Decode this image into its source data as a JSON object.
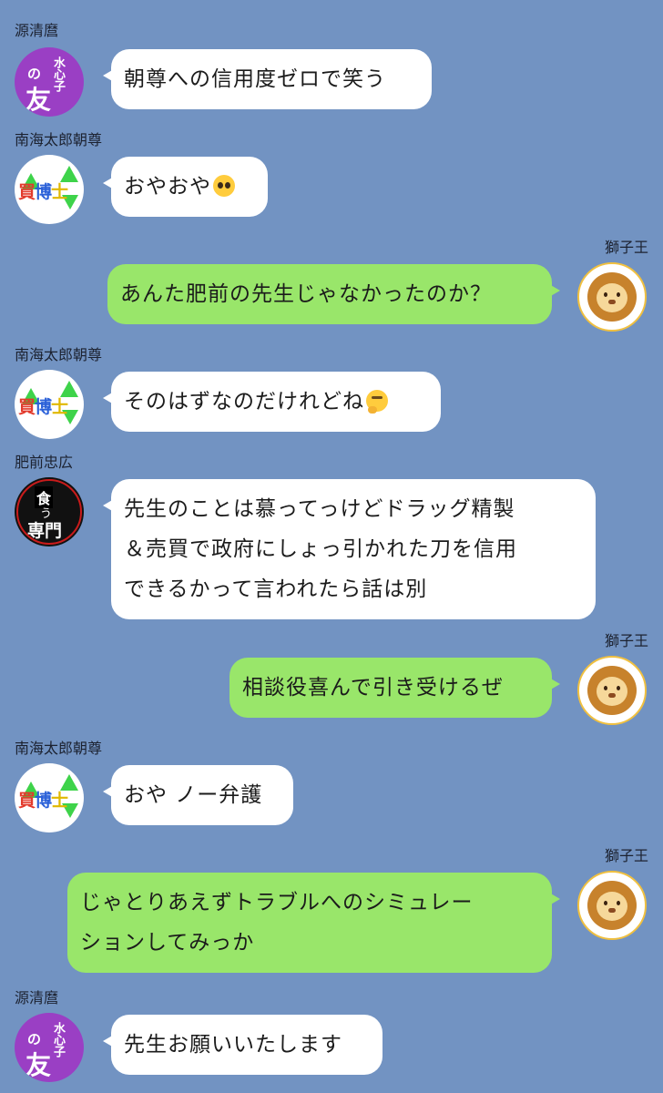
{
  "names": {
    "minamoto": "源清麿",
    "nankai": "南海太郎朝尊",
    "shishio": "獅子王",
    "hizen": "肥前忠広"
  },
  "avatars": {
    "tomo": {
      "line1": "水心子",
      "line2": "の",
      "line3": "友"
    },
    "kai": {
      "c1": "買",
      "c2": "博",
      "c3": "士"
    },
    "kuu": {
      "line1": "食",
      "line2": "う",
      "line3": "専門"
    }
  },
  "messages": [
    {
      "sender": "源清麿",
      "text": "朝尊への信用度ゼロで笑う"
    },
    {
      "sender": "南海太郎朝尊",
      "text": "おやおや",
      "emoji": "pleading-face"
    },
    {
      "sender": "獅子王",
      "text": "あんた肥前の先生じゃなかったのか？"
    },
    {
      "sender": "南海太郎朝尊",
      "text": "そのはずなのだけれどね",
      "emoji": "thinking-face"
    },
    {
      "sender": "肥前忠広",
      "lines": [
        "先生のことは慕ってっけどドラッグ精製",
        "＆売買で政府にしょっ引かれた刀を信用",
        "できるかって言われたら話は別"
      ]
    },
    {
      "sender": "獅子王",
      "text": "相談役喜んで引き受けるぜ"
    },
    {
      "sender": "南海太郎朝尊",
      "text": "おや ノー弁護"
    },
    {
      "sender": "獅子王",
      "lines": [
        "じゃとりあえずトラブルへのシミュレー",
        "ションしてみっか"
      ]
    },
    {
      "sender": "源清麿",
      "text": "先生お願いいたします"
    }
  ]
}
